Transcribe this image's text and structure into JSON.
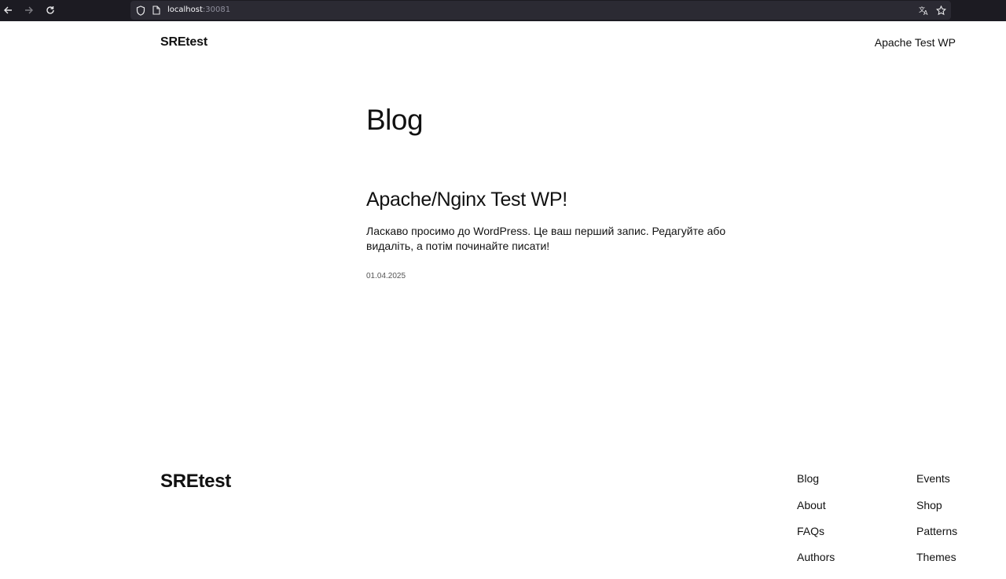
{
  "browser": {
    "url_host": "localhost",
    "url_port": ":30081",
    "icons": [
      "back-arrow-icon",
      "forward-arrow-icon",
      "reload-icon",
      "shield-icon",
      "page-icon",
      "translate-icon",
      "star-icon"
    ]
  },
  "header": {
    "site_title": "SREtest",
    "nav_link": "Apache Test WP"
  },
  "main": {
    "heading": "Blog",
    "posts": [
      {
        "title": "Apache/Nginx Test WP!",
        "excerpt": "Ласкаво просимо до WordPress. Це ваш перший запис. Редагуйте або видаліть, а потім починайте писати!",
        "date": "01.04.2025"
      }
    ]
  },
  "footer": {
    "site_title": "SREtest",
    "links_col1": [
      "Blog",
      "About",
      "FAQs",
      "Authors"
    ],
    "links_col2": [
      "Events",
      "Shop",
      "Patterns",
      "Themes"
    ]
  }
}
